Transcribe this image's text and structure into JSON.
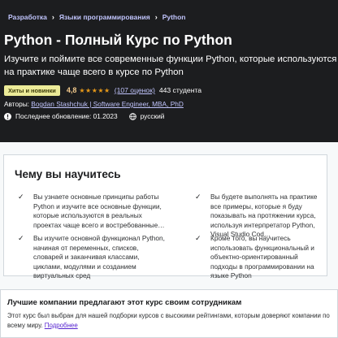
{
  "breadcrumb": [
    "Разработка",
    "Языки программирования",
    "Python"
  ],
  "course": {
    "title": "Python - Полный Курс по Python",
    "subtitle": "Изучите и поймите все современные функции Python, которые используются на практике чаще всего в курсе по Python",
    "badge": "Хиты и новинки",
    "rating": "4,8",
    "rating_count": "(107 оценок)",
    "students": "443 студента",
    "authors_label": "Авторы:",
    "authors": "Bogdan Stashchuk | Software Engineer, MBA, PhD",
    "updated": "Последнее обновление: 01.2023",
    "language": "русский",
    "stars_value": 4.8,
    "stars_max": 5
  },
  "learn": {
    "heading": "Чему вы научитесь",
    "items": [
      "Вы узнаете основные принципы работы Python и изучите все основные функции, которые используются в реальных проектах чаще всего и востребованные…",
      "Вы будете выполнять на практике все примеры, которые я буду показывать на протяжении курса, используя интерпретатор Python, Visual Studio Cod…",
      "Вы изучите основной функционал Python, начиная от переменных, списков, словарей и заканчивая классами, циклами, модулями и созданием виртуальных сред",
      "Кроме того, вы научитесь использовать функциональный и объектно-ориентированный подходы в программировании на языке Python"
    ]
  },
  "companies": {
    "heading": "Лучшие компании предлагают этот курс своим сотрудникам",
    "text": "Этот курс был выбран для нашей подборки курсов с высокими рейтингами, которым доверяют компании по всему миру.",
    "link": "Подробнее"
  },
  "colors": {
    "hero_bg": "#1c1d1f",
    "link_purple": "#c0c4fc",
    "badge_bg": "#eceb98",
    "star": "#e59819",
    "rating_text": "#f3ca8c",
    "more_link": "#5624d0"
  }
}
